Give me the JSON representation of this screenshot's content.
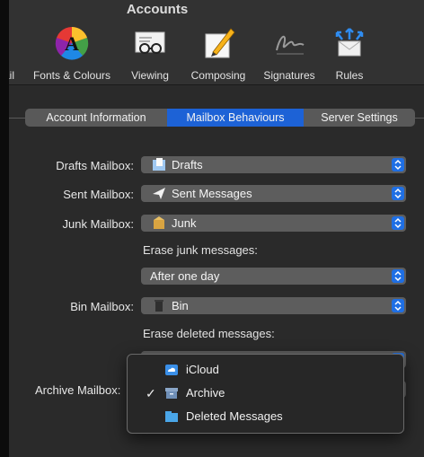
{
  "window": {
    "title": "Accounts"
  },
  "toolbar": {
    "items": [
      {
        "label": "ail",
        "icon": "mail-icon"
      },
      {
        "label": "Fonts & Colours",
        "icon": "color-wheel-icon"
      },
      {
        "label": "Viewing",
        "icon": "viewing-glasses-icon"
      },
      {
        "label": "Composing",
        "icon": "pencil-paper-icon"
      },
      {
        "label": "Signatures",
        "icon": "signature-icon"
      },
      {
        "label": "Rules",
        "icon": "rules-envelope-icon"
      }
    ]
  },
  "tabs": {
    "items": [
      "Account Information",
      "Mailbox Behaviours",
      "Server Settings"
    ],
    "selected": "Mailbox Behaviours"
  },
  "mailboxes": {
    "drafts": {
      "label": "Drafts Mailbox:",
      "value": "Drafts",
      "icon": "drafts-folder-icon"
    },
    "sent": {
      "label": "Sent Mailbox:",
      "value": "Sent Messages",
      "icon": "paper-plane-icon"
    },
    "junk": {
      "label": "Junk Mailbox:",
      "value": "Junk",
      "icon": "junk-box-icon"
    },
    "erase_junk": {
      "label": "Erase junk messages:",
      "value": "After one day"
    },
    "bin": {
      "label": "Bin Mailbox:",
      "value": "Bin",
      "icon": "bin-icon"
    },
    "erase_deleted": {
      "label": "Erase deleted messages:"
    },
    "archive": {
      "label": "Archive Mailbox:"
    }
  },
  "archive_menu": {
    "items": [
      {
        "label": "iCloud",
        "icon": "icloud-icon",
        "checked": false
      },
      {
        "label": "Archive",
        "icon": "archive-box-icon",
        "checked": true
      },
      {
        "label": "Deleted Messages",
        "icon": "folder-icon",
        "checked": false
      }
    ],
    "check_glyph": "✓"
  },
  "colors": {
    "accent": "#1d62d6",
    "window_bg": "#2a2a2a",
    "popup_bg": "#5d5d5d"
  }
}
